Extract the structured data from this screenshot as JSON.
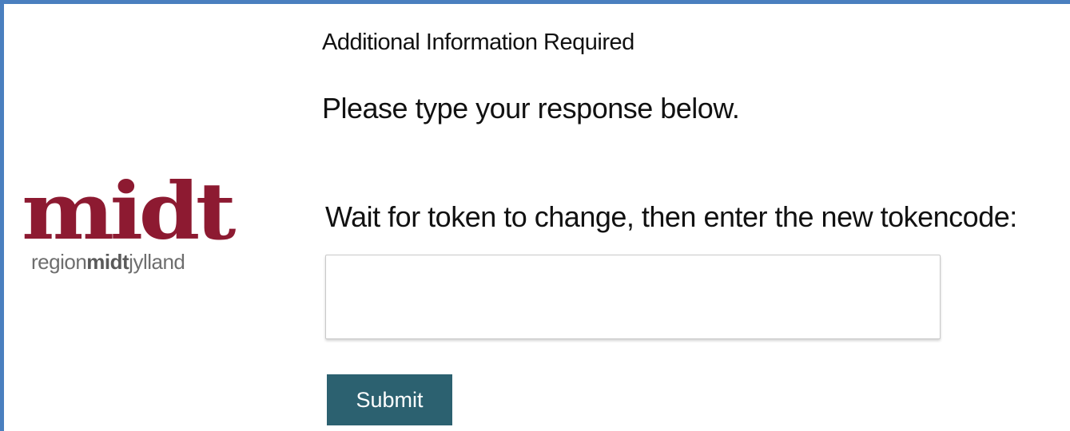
{
  "logo": {
    "mark": "midt",
    "tagline_regular_start": "region",
    "tagline_bold": "midt",
    "tagline_regular_end": "jylland",
    "mark_color": "#8d1a31"
  },
  "form": {
    "heading": "Additional Information Required",
    "instruction": "Please type your response below.",
    "prompt": "Wait for token to change, then enter the new tokencode:",
    "token_value": "",
    "submit_label": "Submit"
  },
  "colors": {
    "frame_border": "#4a7fbf",
    "submit_bg": "#2c6170"
  }
}
